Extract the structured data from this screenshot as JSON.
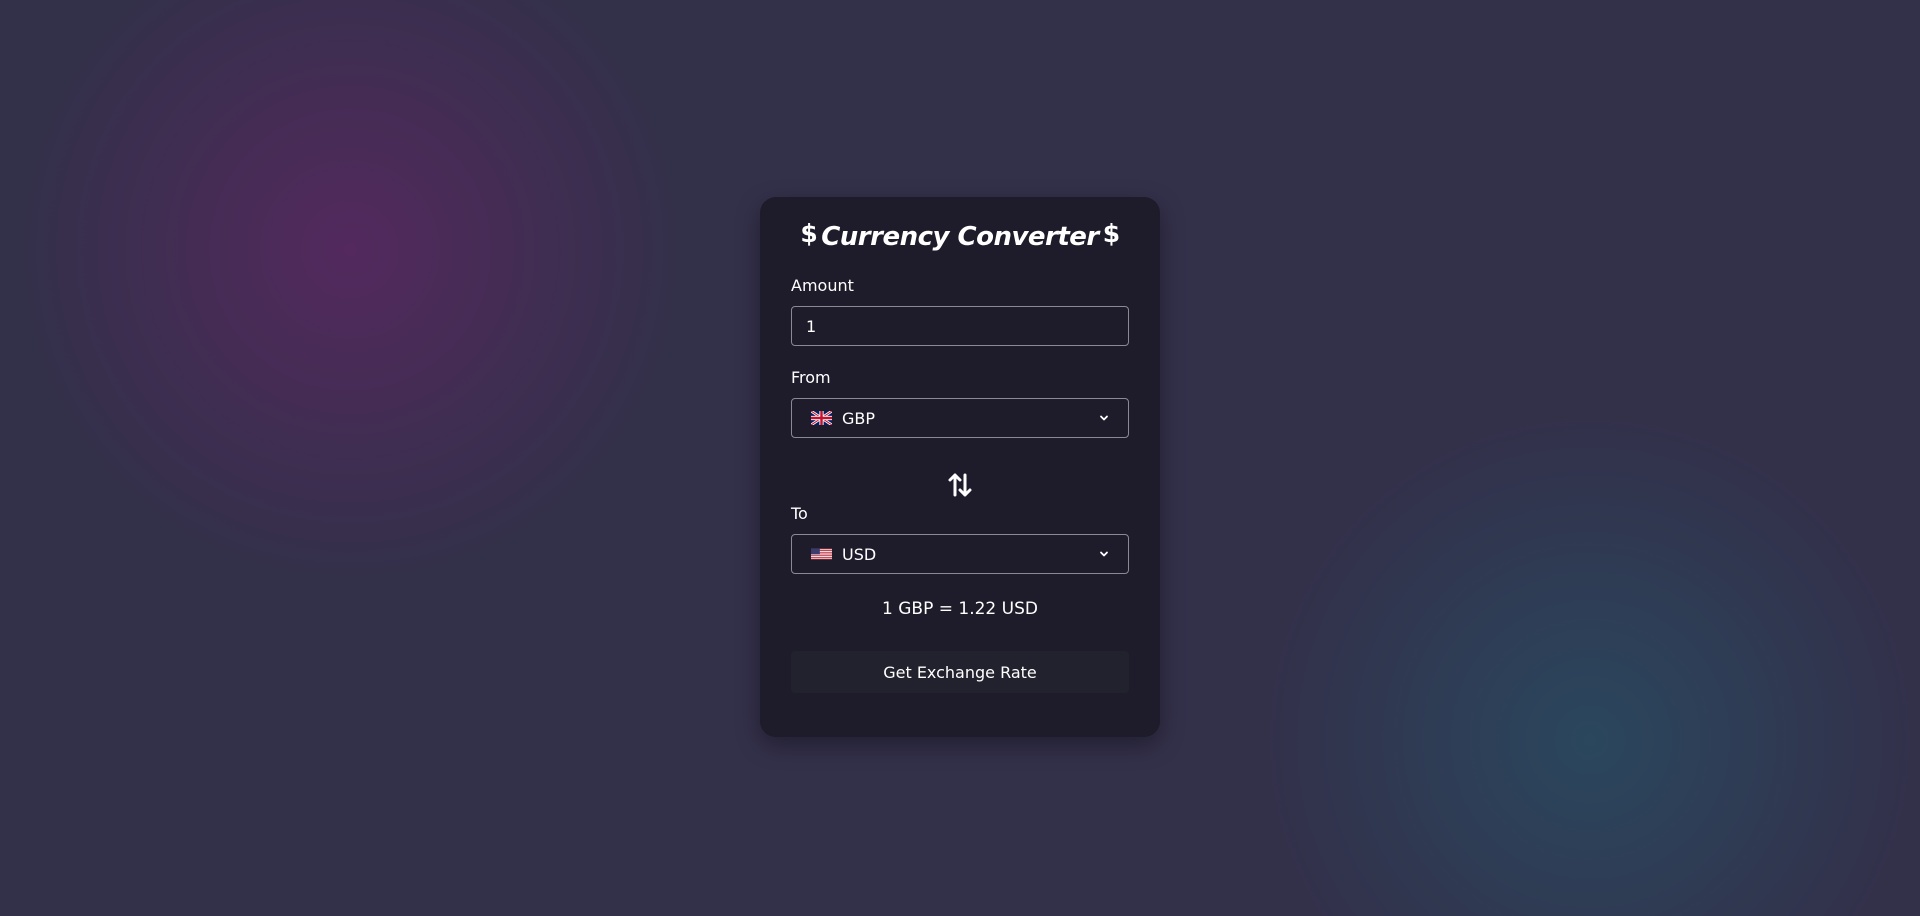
{
  "header": {
    "title": "Currency Converter",
    "left_symbol": "$",
    "right_symbol": "$"
  },
  "amount": {
    "label": "Amount",
    "value": "1"
  },
  "from": {
    "label": "From",
    "currency": "GBP",
    "flag_icon": "uk-flag-icon"
  },
  "to": {
    "label": "To",
    "currency": "USD",
    "flag_icon": "us-flag-icon"
  },
  "swap_icon": "swap-arrows-icon",
  "result": {
    "text": "1 GBP = 1.22 USD"
  },
  "action": {
    "button_label": "Get Exchange Rate"
  },
  "colors": {
    "background": "#33304a",
    "card": "#1e1c2a",
    "field_border": "#8b8995",
    "button": "#22222e",
    "text": "#ffffff",
    "glow_purple": "#6e236e",
    "glow_teal": "#235a6e"
  }
}
